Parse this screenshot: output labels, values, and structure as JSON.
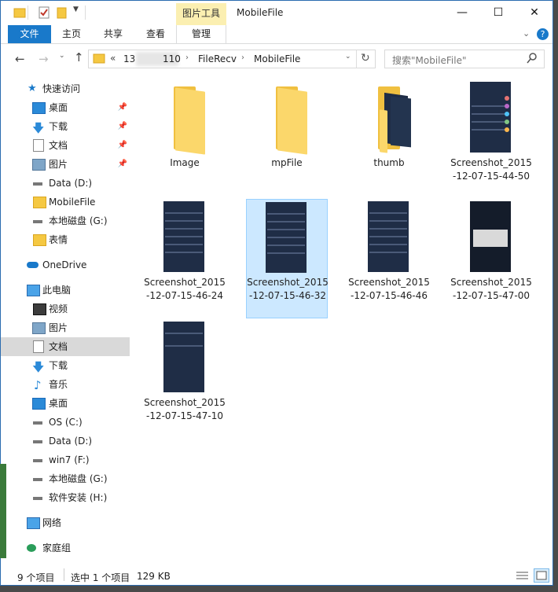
{
  "title": "MobileFile",
  "contextual_tab": "图片工具",
  "ribbon_tabs": {
    "file": "文件",
    "home": "主页",
    "share": "共享",
    "view": "查看",
    "manage": "管理"
  },
  "address": {
    "root": "13",
    "masked": "",
    "tail": "110",
    "p2": "FileRecv",
    "p3": "MobileFile",
    "overflow": "«"
  },
  "search_placeholder": "搜索\"MobileFile\"",
  "sidebar": {
    "quick_access": "快速访问",
    "desktop": "桌面",
    "downloads": "下载",
    "documents": "文档",
    "pictures": "图片",
    "data_d": "Data (D:)",
    "mobilefile": "MobileFile",
    "local_g": "本地磁盘 (G:)",
    "emoji": "表情",
    "onedrive": "OneDrive",
    "thispc": "此电脑",
    "videos": "视频",
    "pictures2": "图片",
    "documents2": "文档",
    "downloads2": "下载",
    "music": "音乐",
    "desktop2": "桌面",
    "os_c": "OS (C:)",
    "data_d2": "Data (D:)",
    "win7_f": "win7 (F:)",
    "local_g2": "本地磁盘 (G:)",
    "software_h": "软件安装 (H:)",
    "network": "网络",
    "homegroup": "家庭组"
  },
  "files": [
    {
      "name": "Image"
    },
    {
      "name": "mpFile"
    },
    {
      "name": "thumb"
    },
    {
      "name": "Screenshot_2015-12-07-15-44-50"
    },
    {
      "name": "Screenshot_2015-12-07-15-46-24"
    },
    {
      "name": "Screenshot_2015-12-07-15-46-32"
    },
    {
      "name": "Screenshot_2015-12-07-15-46-46"
    },
    {
      "name": "Screenshot_2015-12-07-15-47-00"
    },
    {
      "name": "Screenshot_2015-12-07-15-47-10"
    }
  ],
  "status": {
    "count": "9 个项目",
    "selected": "选中 1 个项目",
    "size": "129 KB"
  }
}
